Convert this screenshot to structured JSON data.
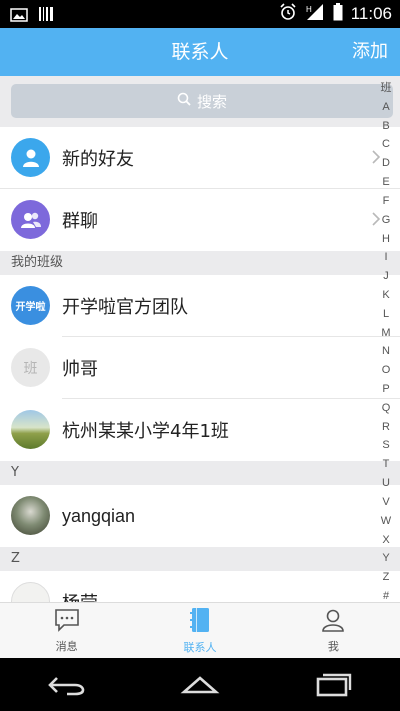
{
  "status_bar": {
    "time": "11:06",
    "icons": [
      "image-icon",
      "barcode-icon",
      "alarm-icon",
      "signal-icon",
      "battery-icon"
    ]
  },
  "header": {
    "title": "联系人",
    "add_label": "添加",
    "color": "#52b2f2"
  },
  "search": {
    "placeholder": "搜索"
  },
  "top_items": [
    {
      "label": "新的好友",
      "icon": "new-friend-icon",
      "color": "#3ba7ec"
    },
    {
      "label": "群聊",
      "icon": "group-chat-icon",
      "color": "#7d69db"
    }
  ],
  "sections": [
    {
      "title": "我的班级"
    },
    {
      "title": "Y"
    },
    {
      "title": "Z"
    }
  ],
  "classes": [
    {
      "label": "开学啦官方团队",
      "avatar_text": "开学啦"
    },
    {
      "label": "帅哥",
      "avatar_text": "班"
    },
    {
      "label": "杭州某某小学4年1班"
    }
  ],
  "contacts_y": [
    {
      "label": "yangqian"
    }
  ],
  "contacts_z": [
    {
      "label": "杨莹"
    }
  ],
  "index_letters": [
    "班",
    "A",
    "B",
    "C",
    "D",
    "E",
    "F",
    "G",
    "H",
    "I",
    "J",
    "K",
    "L",
    "M",
    "N",
    "O",
    "P",
    "Q",
    "R",
    "S",
    "T",
    "U",
    "V",
    "W",
    "X",
    "Y",
    "Z",
    "#"
  ],
  "tabs": [
    {
      "label": "消息",
      "icon": "message-icon",
      "active": false
    },
    {
      "label": "联系人",
      "icon": "contacts-book-icon",
      "active": true
    },
    {
      "label": "我",
      "icon": "person-icon",
      "active": false
    }
  ],
  "nav": [
    "back-icon",
    "home-icon",
    "recent-apps-icon"
  ]
}
